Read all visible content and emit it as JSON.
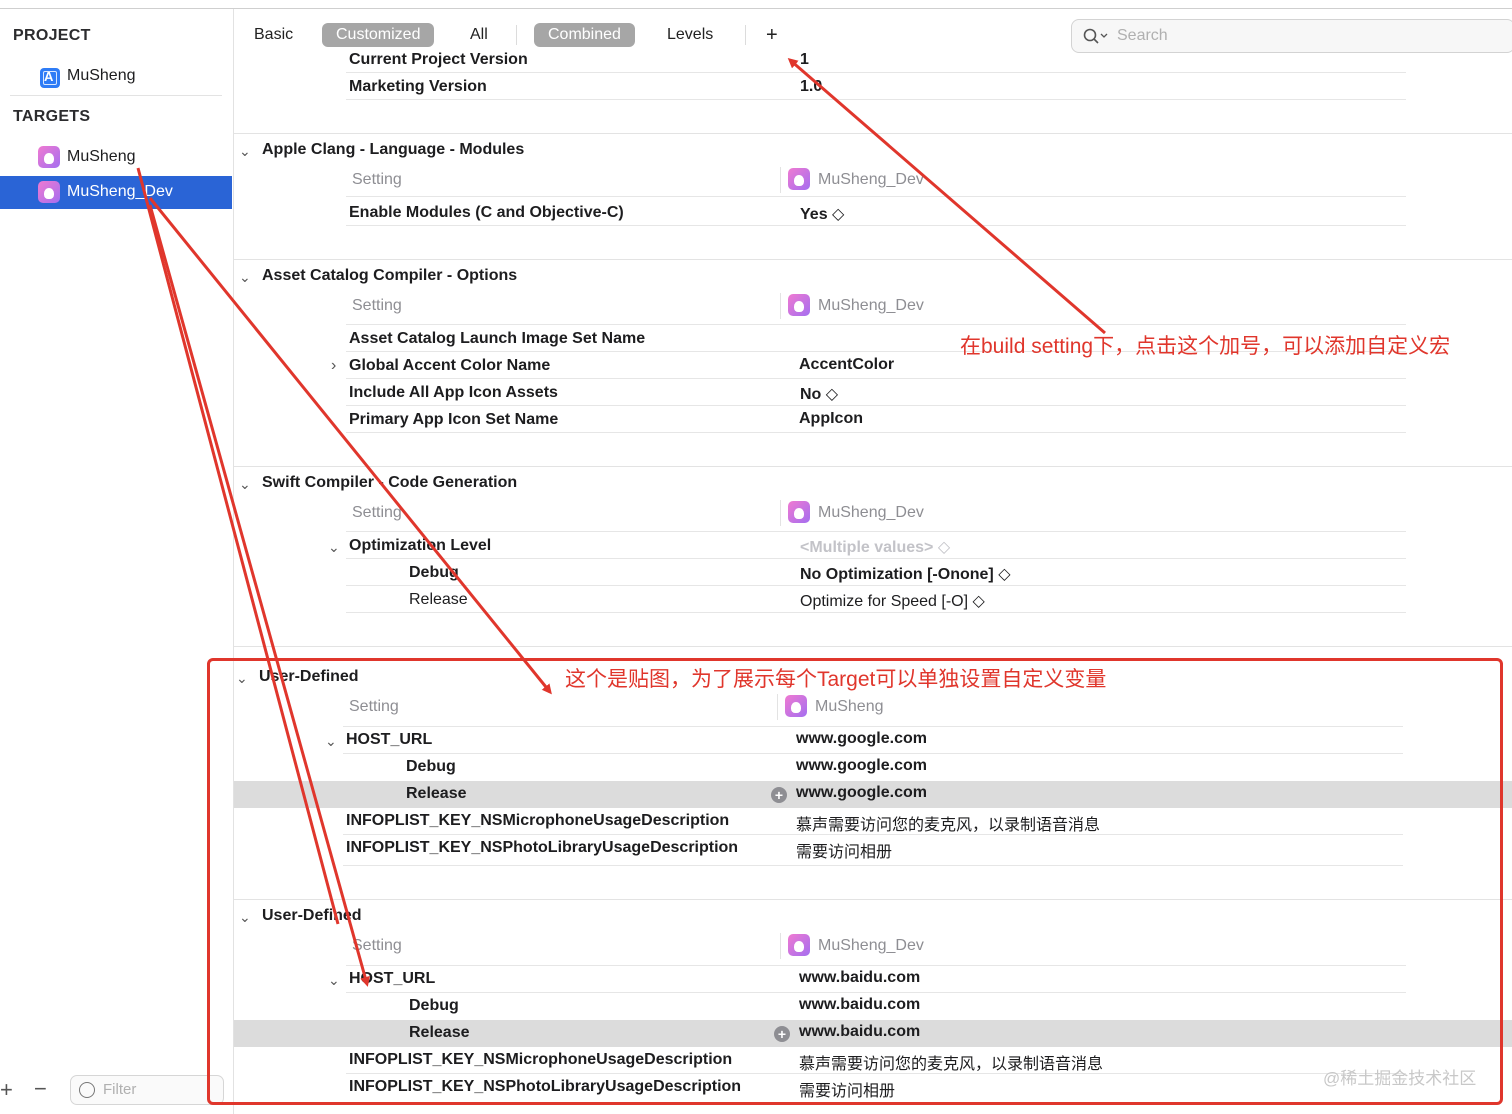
{
  "sidebar": {
    "project_header": "PROJECT",
    "project_item": "MuSheng",
    "targets_header": "TARGETS",
    "targets": [
      "MuSheng",
      "MuSheng_Dev"
    ],
    "selected_target": "MuSheng_Dev",
    "filter_placeholder": "Filter"
  },
  "toolbar": {
    "tabs": [
      "Basic",
      "Customized",
      "All"
    ],
    "active_tab": "Customized",
    "view_tabs": [
      "Combined",
      "Levels"
    ],
    "active_view": "Combined",
    "add_button": "+",
    "search_placeholder": "Search"
  },
  "versioning": {
    "current_project_version_label": "Current Project Version",
    "current_project_version_value": "1",
    "marketing_version_label": "Marketing Version",
    "marketing_version_value": "1.0"
  },
  "sections": {
    "clang_modules": {
      "title": "Apple Clang - Language - Modules",
      "setting_header": "Setting",
      "target_header": "MuSheng_Dev",
      "enable_modules_label": "Enable Modules (C and Objective-C)",
      "enable_modules_value": "Yes ◇"
    },
    "asset_catalog": {
      "title": "Asset Catalog Compiler - Options",
      "setting_header": "Setting",
      "target_header": "MuSheng_Dev",
      "launch_image_label": "Asset Catalog Launch Image Set Name",
      "launch_image_value": "",
      "accent_label": "Global Accent Color Name",
      "accent_value": "AccentColor",
      "include_icons_label": "Include All App Icon Assets",
      "include_icons_value": "No ◇",
      "primary_icon_label": "Primary App Icon Set Name",
      "primary_icon_value": "AppIcon"
    },
    "swift_codegen": {
      "title": "Swift Compiler - Code Generation",
      "setting_header": "Setting",
      "target_header": "MuSheng_Dev",
      "optimization_label": "Optimization Level",
      "optimization_value": "<Multiple values> ◇",
      "debug_label": "Debug",
      "debug_value": "No Optimization [-Onone] ◇",
      "release_label": "Release",
      "release_value": "Optimize for Speed [-O] ◇"
    },
    "user_defined_1": {
      "title": "User-Defined",
      "setting_header": "Setting",
      "target_header": "MuSheng",
      "host_url_label": "HOST_URL",
      "host_url_value": "www.google.com",
      "debug_label": "Debug",
      "debug_value": "www.google.com",
      "release_label": "Release",
      "release_value": "www.google.com",
      "mic_label": "INFOPLIST_KEY_NSMicrophoneUsageDescription",
      "mic_value": "慕声需要访问您的麦克风，以录制语音消息",
      "photo_label": "INFOPLIST_KEY_NSPhotoLibraryUsageDescription",
      "photo_value": "需要访问相册"
    },
    "user_defined_2": {
      "title": "User-Defined",
      "setting_header": "Setting",
      "target_header": "MuSheng_Dev",
      "host_url_label": "HOST_URL",
      "host_url_value": "www.baidu.com",
      "debug_label": "Debug",
      "debug_value": "www.baidu.com",
      "release_label": "Release",
      "release_value": "www.baidu.com",
      "mic_label": "INFOPLIST_KEY_NSMicrophoneUsageDescription",
      "mic_value": "慕声需要访问您的麦克风，以录制语音消息",
      "photo_label": "INFOPLIST_KEY_NSPhotoLibraryUsageDescription",
      "photo_value": "需要访问相册"
    }
  },
  "annotations": {
    "plus_note": "在build setting下，点击这个加号，可以添加自定义宏",
    "paste_note": "这个是贴图，为了展示每个Target可以单独设置自定义变量",
    "watermark": "@稀土掘金技术社区"
  },
  "colors": {
    "selection": "#2a64d6",
    "annotation_red": "#e0362c",
    "active_tab": "#a6a6a6"
  }
}
